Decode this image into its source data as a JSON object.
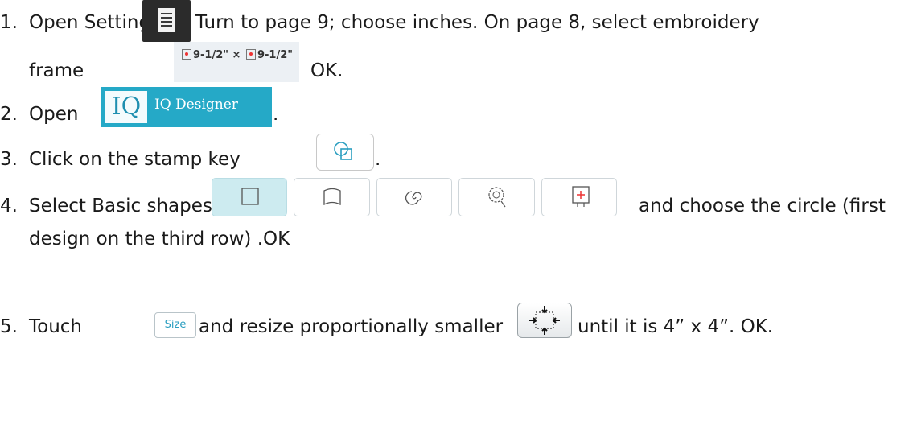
{
  "steps": [
    {
      "number": "1.",
      "text_a": "Open Settings",
      "text_b": "Turn to page 9; choose inches. On page 8, select embroidery",
      "text_c": "frame",
      "text_d": "OK."
    },
    {
      "number": "2.",
      "text_a": "Open",
      "text_b": "."
    },
    {
      "number": "3.",
      "text_a": "Click on the stamp key",
      "text_b": "."
    },
    {
      "number": "4.",
      "text_a": "Select Basic shapes",
      "text_b": "and choose the circle (first",
      "text_c": "design on the third row) .OK"
    },
    {
      "number": "5.",
      "text_a": "Touch",
      "text_b": "and resize proportionally smaller",
      "text_c": "until it is 4” x 4”. OK."
    }
  ],
  "icons": {
    "settings": "settings-page-icon",
    "frame_left": "9-1/2\"",
    "frame_sep": "×",
    "frame_right": "9-1/2\"",
    "iq_logo": "IQ",
    "iq_label": "IQ Designer",
    "stamp": "stamp-shapes-icon",
    "size_label": "Size",
    "resize": "proportional-resize-icon",
    "tabs": [
      "square-icon",
      "flag-icon",
      "spiral-icon",
      "flower-icon",
      "frame-image-icon"
    ]
  },
  "colors": {
    "iq_blue": "#25a9c7",
    "accent_teal": "#2a9ec0",
    "active_tab": "#cdebf0"
  }
}
